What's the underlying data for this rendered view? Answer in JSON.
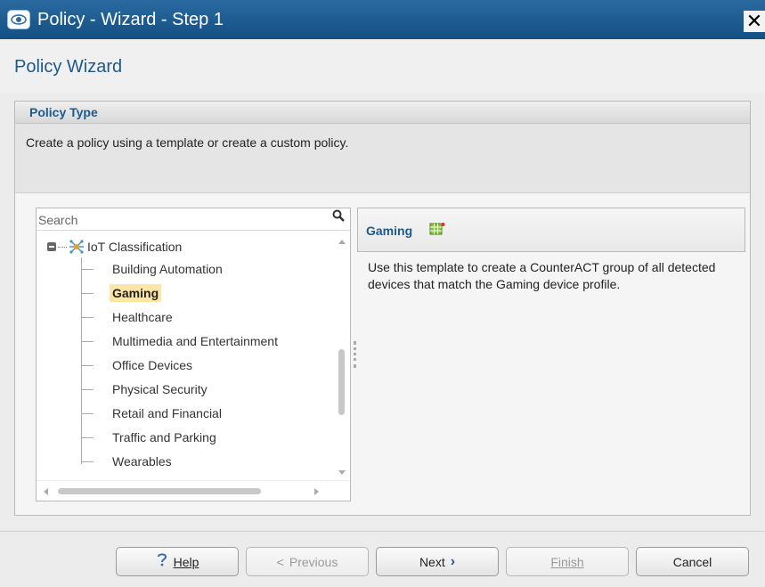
{
  "window": {
    "title": "Policy - Wizard - Step 1",
    "close_label": "✕"
  },
  "header": {
    "title": "Policy Wizard"
  },
  "policy_type": {
    "heading": "Policy Type",
    "description": "Create a policy using a template or create a custom policy."
  },
  "search": {
    "placeholder": "Search"
  },
  "tree": {
    "root_label": "IoT Classification",
    "items": [
      {
        "label": "Building Automation"
      },
      {
        "label": "Gaming"
      },
      {
        "label": "Healthcare"
      },
      {
        "label": "Multimedia and Entertainment"
      },
      {
        "label": "Office Devices"
      },
      {
        "label": "Physical Security"
      },
      {
        "label": "Retail and Financial"
      },
      {
        "label": "Traffic and Parking"
      },
      {
        "label": "Wearables"
      }
    ],
    "selected": "Gaming"
  },
  "detail": {
    "title": "Gaming",
    "description": "Use this template to create a CounterACT group of all detected devices that match the Gaming device profile."
  },
  "buttons": {
    "help": "Help",
    "previous": "Previous",
    "next": "Next",
    "finish": "Finish",
    "cancel": "Cancel"
  }
}
